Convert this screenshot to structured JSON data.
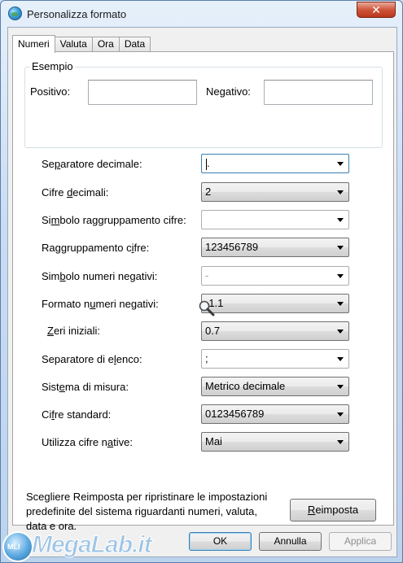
{
  "window": {
    "title": "Personalizza formato",
    "close_symbol": "✕"
  },
  "tabs": [
    {
      "label": "Numeri",
      "active": true
    },
    {
      "label": "Valuta",
      "active": false
    },
    {
      "label": "Ora",
      "active": false
    },
    {
      "label": "Data",
      "active": false
    }
  ],
  "example": {
    "group_title": "Esempio",
    "positive_label": "Positivo:",
    "positive_value": "",
    "negative_label": "Negativo:",
    "negative_value": ""
  },
  "rows": [
    {
      "key": "decimal-separator",
      "label_pre": "Se",
      "label_u": "p",
      "label_post": "aratore decimale:",
      "value": ".",
      "kind": "editable",
      "focused": true
    },
    {
      "key": "decimal-digits",
      "label_pre": "Cifre ",
      "label_u": "d",
      "label_post": "ecimali:",
      "value": "2",
      "kind": "dropdown"
    },
    {
      "key": "grouping-symbol",
      "label_pre": "Si",
      "label_u": "m",
      "label_post": "bolo raggruppamento cifre:",
      "value": "",
      "kind": "editable"
    },
    {
      "key": "digit-grouping",
      "label_pre": "Raggruppamento c",
      "label_u": "i",
      "label_post": "fre:",
      "value": "123456789",
      "kind": "dropdown"
    },
    {
      "key": "negative-sign",
      "label_pre": "Sim",
      "label_u": "b",
      "label_post": "olo numeri negativi:",
      "value": "-",
      "kind": "editable",
      "grey": true
    },
    {
      "key": "negative-format",
      "label_pre": "Formato n",
      "label_u": "u",
      "label_post": "meri negativi:",
      "value": "-1.1",
      "kind": "dropdown"
    },
    {
      "key": "leading-zeros",
      "label_pre": "",
      "label_u": "Z",
      "label_post": "eri iniziali:",
      "value": "0.7",
      "kind": "dropdown"
    },
    {
      "key": "list-separator",
      "label_pre": "Separatore di e",
      "label_u": "l",
      "label_post": "enco:",
      "value": ";",
      "kind": "editable"
    },
    {
      "key": "measurement-system",
      "label_pre": "Sist",
      "label_u": "e",
      "label_post": "ma di misura:",
      "value": "Metrico decimale",
      "kind": "dropdown"
    },
    {
      "key": "standard-digits",
      "label_pre": "Ci",
      "label_u": "f",
      "label_post": "re standard:",
      "value": "0123456789",
      "kind": "dropdown"
    },
    {
      "key": "native-digits",
      "label_pre": "Utilizza cifre n",
      "label_u": "a",
      "label_post": "tive:",
      "value": "Mai",
      "kind": "dropdown"
    }
  ],
  "note": "Scegliere Reimposta per ripristinare le impostazioni predefinite del sistema riguardanti numeri, valuta, data e ora.",
  "reset_button": {
    "u": "R",
    "rest": "eimposta"
  },
  "buttons": {
    "ok": "OK",
    "cancel": "Annulla",
    "apply": "Applica"
  },
  "watermark": {
    "badge": "MLI",
    "text": "MegaLab.it"
  },
  "icons": {
    "app": "globe-icon",
    "close": "close-icon",
    "dropdown": "chevron-down-icon",
    "cursor": "magnifier-cursor-icon"
  }
}
